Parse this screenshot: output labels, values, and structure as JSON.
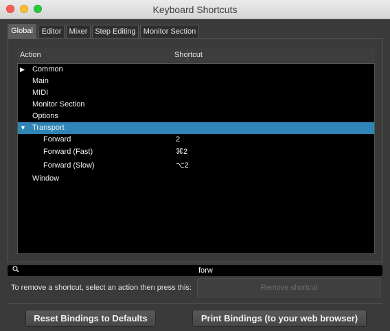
{
  "window": {
    "title": "Keyboard Shortcuts"
  },
  "tabs": [
    {
      "label": "Global"
    },
    {
      "label": "Editor"
    },
    {
      "label": "Mixer"
    },
    {
      "label": "Step Editing"
    },
    {
      "label": "Monitor Section"
    }
  ],
  "table": {
    "headers": {
      "action": "Action",
      "shortcut": "Shortcut"
    },
    "rows": [
      {
        "action": "Common",
        "shortcut": ""
      },
      {
        "action": "Main",
        "shortcut": ""
      },
      {
        "action": "MIDI",
        "shortcut": ""
      },
      {
        "action": "Monitor Section",
        "shortcut": ""
      },
      {
        "action": "Options",
        "shortcut": ""
      },
      {
        "action": "Transport",
        "shortcut": ""
      },
      {
        "action": "Forward",
        "shortcut": "2"
      },
      {
        "action": "Forward (Fast)",
        "shortcut": "⌘2"
      },
      {
        "action": "Forward (Slow)",
        "shortcut": "⌥2"
      },
      {
        "action": "Window",
        "shortcut": ""
      }
    ],
    "icons": {
      "collapsed": "triangle-right-icon",
      "expanded": "triangle-down-icon"
    }
  },
  "search": {
    "value": "forw",
    "icon": "search-icon"
  },
  "remove": {
    "instruction": "To remove a shortcut, select an action then press this:",
    "button": "Remove shortcut"
  },
  "footer": {
    "reset": "Reset Bindings to Defaults",
    "print": "Print Bindings (to your web browser)"
  },
  "colors": {
    "selection": "#2f86b6",
    "list_bg": "#000000",
    "window_bg": "#3a3a3a"
  }
}
